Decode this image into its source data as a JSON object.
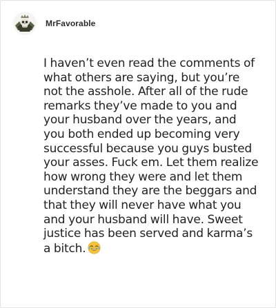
{
  "post": {
    "author": {
      "username": "MrFavorable",
      "avatar_icon": "skull-emblem-avatar"
    },
    "comment_text": "I haven’t even read the comments of what others are saying, but you’re not the asshole. After all of the rude remarks they’ve made to you and your husband over the years, and you both ended up becoming very successful because you guys busted your asses. Fuck em. Let them realize how wrong they were and let them understand they are the beggars and that they will never have what you and your husband will have. Sweet justice has been served and karma’s a bitch.",
    "trailing_emoji": "face-with-tears-of-joy-emoji"
  },
  "colors": {
    "text": "#222222",
    "username": "#2b2b2b",
    "border": "#e3e3e3",
    "emoji_face": "#f7c336"
  }
}
